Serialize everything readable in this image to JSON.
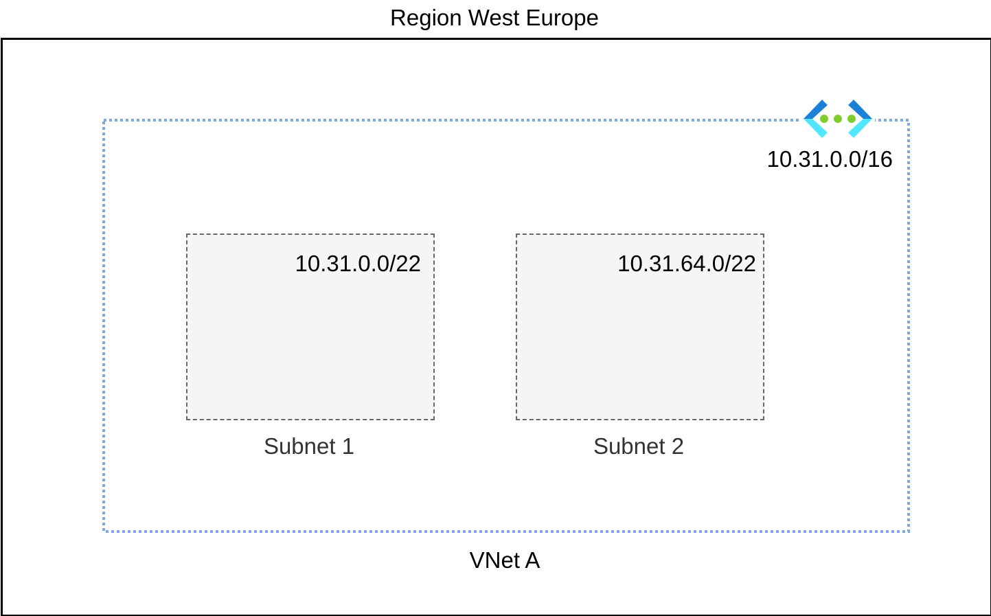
{
  "region": {
    "title": "Region West Europe"
  },
  "vnet": {
    "name": "VNet A",
    "cidr": "10.31.0.0/16",
    "icon": "azure-virtual-network-icon",
    "border_color": "#7ea6e0"
  },
  "subnets": [
    {
      "name": "Subnet 1",
      "cidr": "10.31.0.0/22"
    },
    {
      "name": "Subnet 2",
      "cidr": "10.31.64.0/22"
    }
  ],
  "colors": {
    "icon_blue_dark": "#1b80d6",
    "icon_blue_light": "#50e6ff",
    "icon_green": "#7fcc2f",
    "subnet_fill": "#f5f5f5",
    "subnet_border": "#666666"
  }
}
